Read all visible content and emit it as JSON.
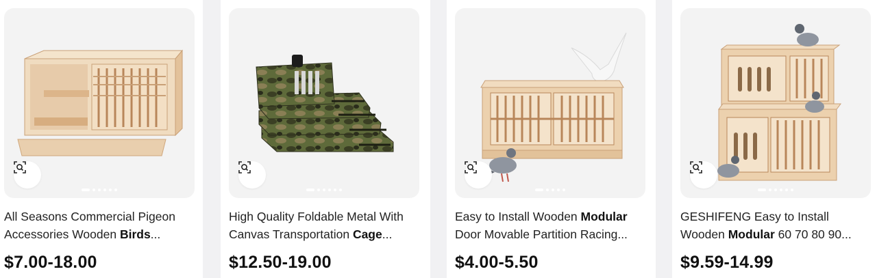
{
  "products": [
    {
      "title_parts": [
        "All Seasons Commercial Pigeon Accessories Wooden ",
        "Birds",
        "..."
      ],
      "price": "$7.00-18.00",
      "image_icon": "wooden-bird-cage-image"
    },
    {
      "title_parts": [
        "High Quality Foldable Metal With Canvas Transportation ",
        "Cage",
        "..."
      ],
      "price": "$12.50-19.00",
      "image_icon": "camouflage-transport-cage-image"
    },
    {
      "title_parts": [
        "Easy to Install Wooden ",
        "Modular",
        " Door Movable Partition Racing..."
      ],
      "price": "$4.00-5.50",
      "image_icon": "wooden-modular-cage-with-pigeons-image"
    },
    {
      "title_parts": [
        "GESHIFENG Easy to Install Wooden ",
        "Modular",
        " 60 70 80 90..."
      ],
      "price": "$9.59-14.99",
      "image_icon": "stacked-wooden-cages-with-pigeons-image"
    }
  ],
  "icons": {
    "image_search": "image-search-icon"
  },
  "colors": {
    "background": "#f1f1f3",
    "card": "#ffffff",
    "image_bg": "#f3f3f3",
    "wood": "#e8c9a4"
  }
}
